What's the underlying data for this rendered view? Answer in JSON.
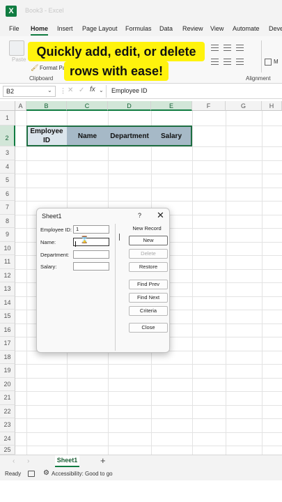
{
  "window": {
    "title": "Book3 - Excel",
    "logo": "X"
  },
  "menu": {
    "tabs": [
      "File",
      "Home",
      "Insert",
      "Page Layout",
      "Formulas",
      "Data",
      "Review",
      "View",
      "Automate",
      "Deve"
    ],
    "active": "Home"
  },
  "ribbon": {
    "paste_label": "Paste",
    "format_painter_label": "Format Pa",
    "clipboard_group": "Clipboard",
    "alignment_group": "Alignment",
    "wrap_label": "M"
  },
  "caption": {
    "line1": "Quickly add, edit, or delete",
    "line2": "rows with ease!"
  },
  "formula_bar": {
    "name_box": "B2",
    "dots": "⋮",
    "cancel": "✕",
    "enter": "✓",
    "fx": "fx",
    "content": "Employee ID"
  },
  "grid": {
    "columns": [
      "A",
      "B",
      "C",
      "D",
      "E",
      "F",
      "G",
      "H"
    ],
    "rows": [
      "1",
      "2",
      "3",
      "4",
      "5",
      "6",
      "7",
      "8",
      "9",
      "10",
      "11",
      "12",
      "13",
      "14",
      "15",
      "16",
      "17",
      "18",
      "19",
      "20",
      "21",
      "22",
      "23",
      "24",
      "25"
    ],
    "header_cells": {
      "b2": "Employee ID",
      "c2": "Name",
      "d2": "Department",
      "e2": "Salary"
    }
  },
  "dialog": {
    "title": "Sheet1",
    "help": "?",
    "close": "✕",
    "record_status": "New Record",
    "fields": {
      "employee_id_label": "Employee ID:",
      "employee_id_value": "1",
      "name_label": "Name:",
      "name_value": "",
      "department_label": "Department:",
      "department_value": "",
      "salary_label": "Salary:",
      "salary_value": ""
    },
    "buttons": {
      "new": "New",
      "delete": "Delete",
      "restore": "Restore",
      "find_prev": "Find Prev",
      "find_next": "Find Next",
      "criteria": "Criteria",
      "close": "Close"
    }
  },
  "sheets": {
    "active": "Sheet1",
    "prev": "‹",
    "next": "›",
    "add": "+"
  },
  "status": {
    "ready": "Ready",
    "accessibility": "Accessibility: Good to go"
  },
  "colors": {
    "excel_green": "#107c41",
    "caption_highlight": "#fff30d",
    "table_header_fill": "#a6b9c7",
    "selected_cell_fill": "#dbe5ec"
  }
}
